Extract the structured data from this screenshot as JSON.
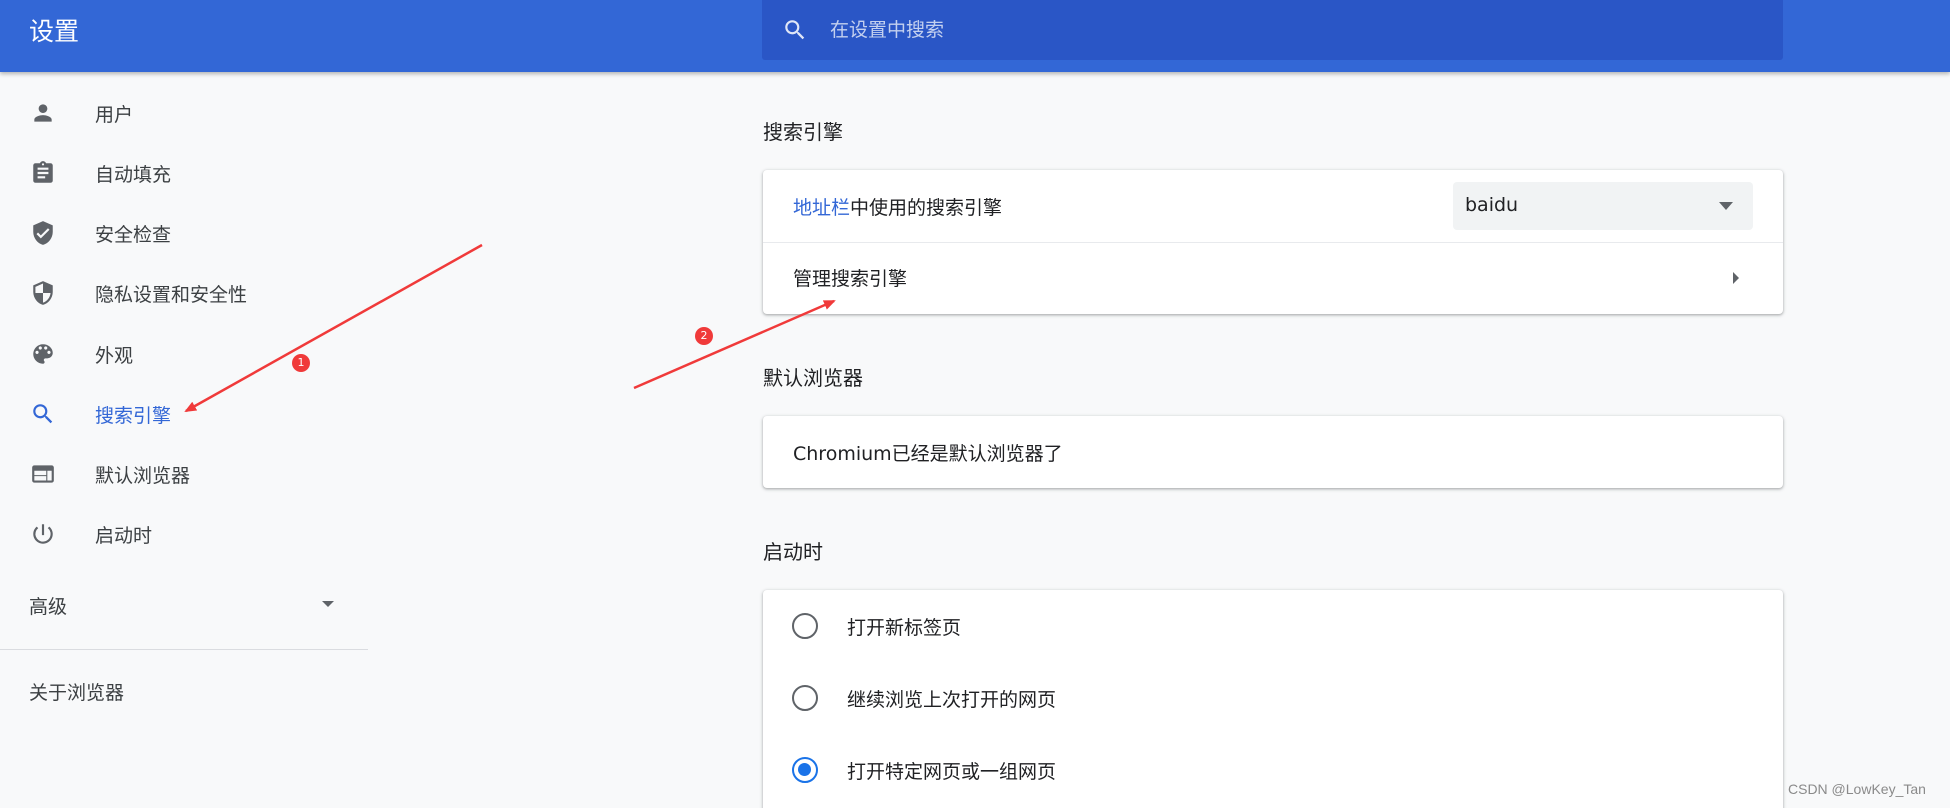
{
  "header": {
    "title": "设置",
    "search_placeholder": "在设置中搜索",
    "search_value": ""
  },
  "sidebar": {
    "items": [
      {
        "label": "用户",
        "icon": "person-icon"
      },
      {
        "label": "自动填充",
        "icon": "clipboard-icon"
      },
      {
        "label": "安全检查",
        "icon": "shield-check-icon"
      },
      {
        "label": "隐私设置和安全性",
        "icon": "shield-half-icon"
      },
      {
        "label": "外观",
        "icon": "palette-icon"
      },
      {
        "label": "搜索引擎",
        "icon": "search-icon",
        "active": true
      },
      {
        "label": "默认浏览器",
        "icon": "browser-icon"
      },
      {
        "label": "启动时",
        "icon": "power-icon"
      }
    ],
    "advanced_label": "高级",
    "about_label": "关于浏览器"
  },
  "search_engine": {
    "title": "搜索引擎",
    "address_bar_link": "地址栏",
    "address_bar_rest": "中使用的搜索引擎",
    "selected_engine": "baidu",
    "manage_label": "管理搜索引擎"
  },
  "default_browser": {
    "title": "默认浏览器",
    "status": "Chromium已经是默认浏览器了"
  },
  "on_startup": {
    "title": "启动时",
    "options": [
      {
        "label": "打开新标签页",
        "checked": false
      },
      {
        "label": "继续浏览上次打开的网页",
        "checked": false
      },
      {
        "label": "打开特定网页或一组网页",
        "checked": true
      }
    ]
  },
  "annotations": {
    "badge_1": "1",
    "badge_2": "2"
  },
  "watermark": "CSDN @LowKey_Tan",
  "colors": {
    "header_blue": "#3367d6",
    "search_box_blue": "#2a56c6",
    "active_blue": "#3367d6",
    "radio_blue": "#1a73e8",
    "annotation_red": "#f03a3a",
    "page_background": "#f8f9fa"
  }
}
